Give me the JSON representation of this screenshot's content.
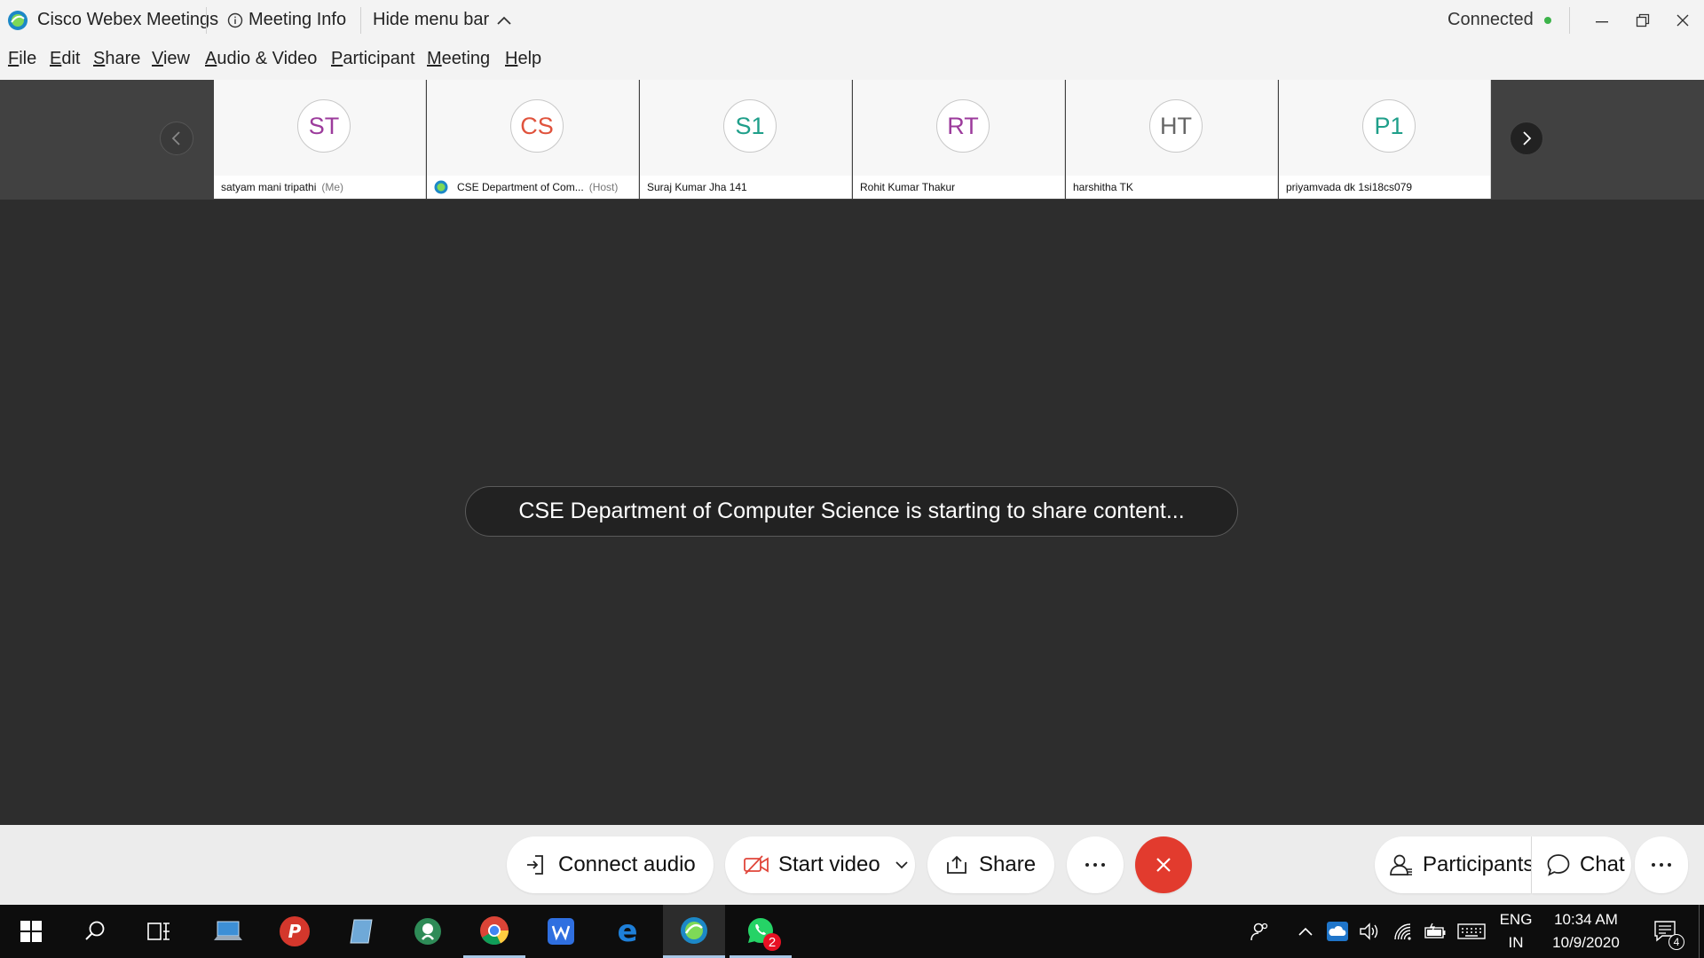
{
  "window": {
    "app_title": "Cisco Webex Meetings",
    "meeting_info": "Meeting Info",
    "hide_menu_bar": "Hide menu bar",
    "status": "Connected",
    "status_color": "#3cb34a"
  },
  "menu": {
    "items": [
      {
        "key": "F",
        "rest": "ile"
      },
      {
        "key": "E",
        "rest": "dit"
      },
      {
        "key": "S",
        "rest": "hare"
      },
      {
        "key": "V",
        "rest": "iew"
      },
      {
        "key": "A",
        "rest": "udio & Video"
      },
      {
        "key": "P",
        "rest": "articipant"
      },
      {
        "key": "M",
        "rest": "eeting"
      },
      {
        "key": "H",
        "rest": "elp"
      }
    ]
  },
  "participants": [
    {
      "initials": "ST",
      "color": "#9c3b9c",
      "name": "satyam mani tripathi",
      "tag": "(Me)"
    },
    {
      "initials": "CS",
      "color": "#e0533d",
      "name": "CSE Department of Com...",
      "tag": "(Host)"
    },
    {
      "initials": "S1",
      "color": "#1f9f8a",
      "name": "Suraj Kumar Jha 141",
      "tag": ""
    },
    {
      "initials": "RT",
      "color": "#9c3b9c",
      "name": "Rohit Kumar Thakur",
      "tag": ""
    },
    {
      "initials": "HT",
      "color": "#666666",
      "name": "harshitha TK",
      "tag": ""
    },
    {
      "initials": "P1",
      "color": "#1f9f8a",
      "name": "priyamvada dk 1si18cs079",
      "tag": ""
    }
  ],
  "stage": {
    "toast": "CSE Department of Computer Science is starting to share content..."
  },
  "controls": {
    "connect_audio": "Connect audio",
    "start_video": "Start video",
    "share": "Share",
    "participants": "Participants",
    "chat": "Chat",
    "end_color": "#e23b2e"
  },
  "taskbar": {
    "language": "ENG",
    "region": "IN",
    "time": "10:34 AM",
    "date": "10/9/2020",
    "notification_count": "4",
    "whatsapp_badge": "2"
  }
}
